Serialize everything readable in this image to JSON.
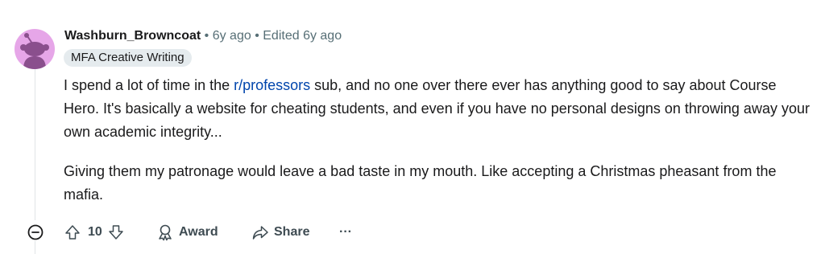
{
  "comment": {
    "author": "Washburn_Browncoat",
    "separator_1": " • ",
    "age": "6y ago",
    "separator_2": " • ",
    "edited": "Edited 6y ago",
    "flair": "MFA Creative Writing",
    "body": {
      "p1_before_link": "I spend a lot of time in the ",
      "p1_link": "r/professors",
      "p1_after_link": " sub, and no one over there ever has anything good to say about Course Hero. It's basically a website for cheating students, and even if you have no personal designs on throwing away your own academic integrity...",
      "p2": "Giving them my patronage would leave a bad taste in my mouth. Like accepting a Christmas pheasant from the mafia."
    },
    "actions": {
      "score": "10",
      "award_label": "Award",
      "share_label": "Share",
      "more_label": "···"
    }
  },
  "colors": {
    "avatar_bg": "#e6a6e8",
    "link": "#0045ac",
    "meta": "#576f76",
    "flair_bg": "#e5ebee"
  },
  "icons": {
    "avatar": "reddit-snoo-avatar-icon",
    "collapse": "minus-circle-icon",
    "upvote": "arrow-up-icon",
    "downvote": "arrow-down-icon",
    "award": "award-icon",
    "share": "share-icon",
    "more": "ellipsis-icon"
  }
}
